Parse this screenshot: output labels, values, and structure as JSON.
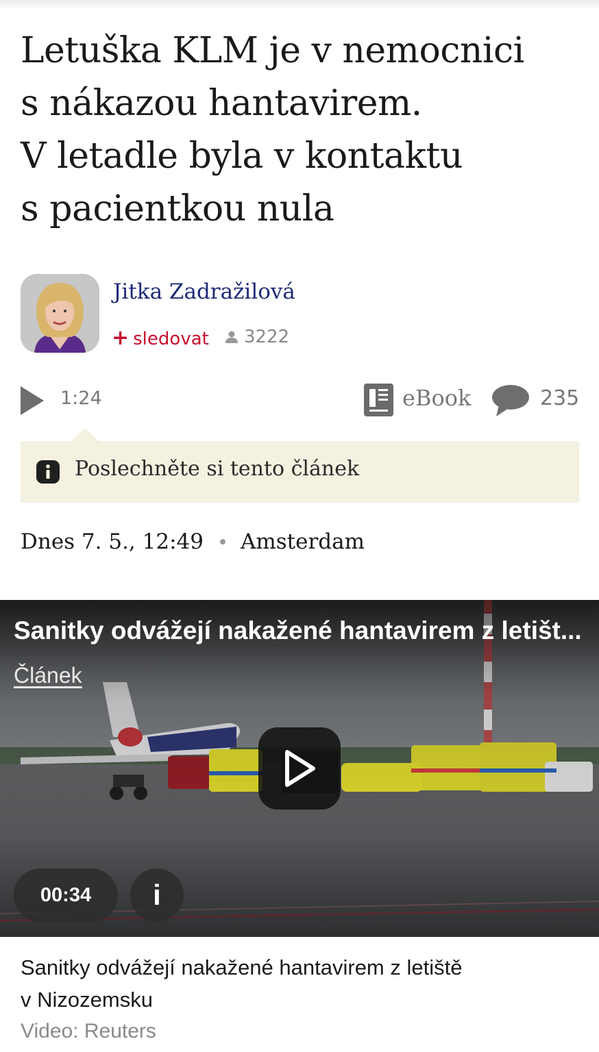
{
  "article": {
    "headline": [
      "Letuška KLM je v nemocnici",
      "s nákazou hantavirem.",
      "V letadle byla v kontaktu",
      "s pacientkou nula"
    ],
    "author": {
      "name": "Jitka Zadražilová",
      "follow_label": "sledovat",
      "followers": "3222"
    },
    "audio": {
      "duration": "1:24"
    },
    "ebook_label": "eBook",
    "comments_count": "235",
    "listen_prompt": "Poslechněte si tento článek",
    "date": "Dnes 7. 5., 12:49",
    "location": "Amsterdam"
  },
  "video": {
    "title": "Sanitky odvážejí nakažené hantavirem z letišt...",
    "link_label": "Článek",
    "time": "00:34",
    "info_label": "i",
    "caption": [
      "Sanitky odvážejí nakažené hantavirem z letiště",
      "v Nizozemsku"
    ],
    "credit": "Video: Reuters"
  },
  "colors": {
    "author_link": "#1e2a78",
    "follow_red": "#c8102e",
    "listen_box_bg": "#f4f1e1",
    "muted_gray": "#777777"
  }
}
